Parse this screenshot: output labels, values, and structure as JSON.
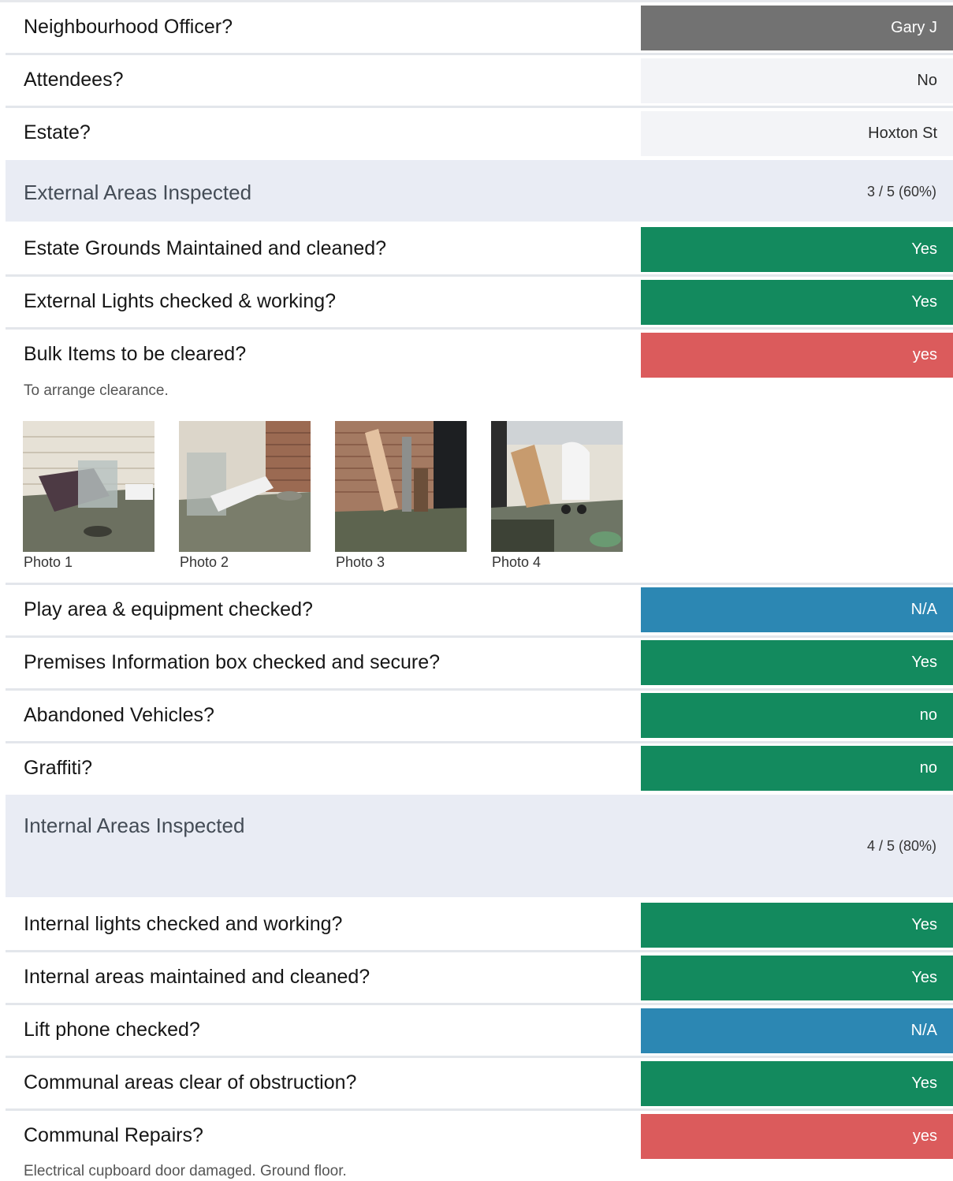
{
  "rows": {
    "officer": {
      "question": "Neighbourhood Officer?",
      "answer": "Gary J"
    },
    "attendees": {
      "question": "Attendees?",
      "answer": "No"
    },
    "estate": {
      "question": "Estate?",
      "answer": "Hoxton St"
    },
    "grounds": {
      "question": "Estate Grounds Maintained and cleaned?",
      "answer": "Yes"
    },
    "ext_lights": {
      "question": "External Lights checked & working?",
      "answer": "Yes"
    },
    "bulk": {
      "question": "Bulk Items to be cleared?",
      "answer": "yes",
      "note": "To arrange clearance."
    },
    "play": {
      "question": "Play area & equipment checked?",
      "answer": "N/A"
    },
    "premises": {
      "question": "Premises Information box checked and secure?",
      "answer": "Yes"
    },
    "vehicles": {
      "question": "Abandoned Vehicles?",
      "answer": "no"
    },
    "graffiti": {
      "question": "Graffiti?",
      "answer": "no"
    },
    "int_lights": {
      "question": "Internal lights checked and working?",
      "answer": "Yes"
    },
    "int_areas": {
      "question": "Internal areas maintained and cleaned?",
      "answer": "Yes"
    },
    "lift": {
      "question": "Lift phone checked?",
      "answer": "N/A"
    },
    "communal": {
      "question": "Communal areas clear of obstruction?",
      "answer": "Yes"
    },
    "repairs": {
      "question": "Communal Repairs?",
      "answer": "yes",
      "note": "Electrical cupboard door damaged.  Ground floor."
    }
  },
  "sections": {
    "external": {
      "title": "External Areas Inspected",
      "score": "3 / 5 (60%)"
    },
    "internal": {
      "title": "Internal Areas Inspected",
      "score": "4 / 5 (80%)"
    }
  },
  "photos": [
    "Photo 1",
    "Photo 2",
    "Photo 3",
    "Photo 4"
  ],
  "colors": {
    "grey": "#727272",
    "green": "#138a5e",
    "red": "#db5b5c",
    "blue": "#2c87b3",
    "section_bg": "#e9ecf4"
  }
}
